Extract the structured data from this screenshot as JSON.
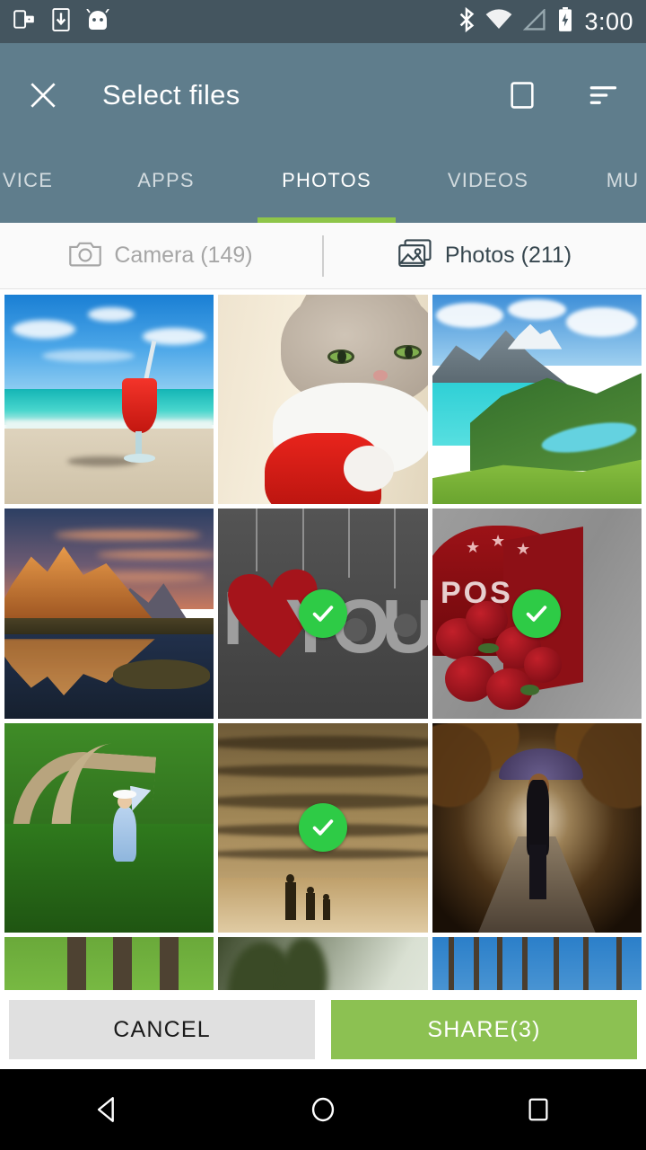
{
  "status_bar": {
    "time": "3:00",
    "left_icons": [
      "screenshot-icon",
      "download-icon",
      "android-head-icon"
    ],
    "right_icons": [
      "bluetooth-icon",
      "wifi-icon",
      "cell-signal-icon",
      "battery-charging-icon"
    ],
    "background_color": "#44555f"
  },
  "toolbar": {
    "title": "Select files",
    "close_icon": "close-icon",
    "select_all_icon": "select-all-square-icon",
    "sort_icon": "sort-icon",
    "background_color": "#5f7d8c",
    "accent_color": "#8ec549"
  },
  "tabs": [
    {
      "label": "VICE",
      "active": false
    },
    {
      "label": "APPS",
      "active": false
    },
    {
      "label": "PHOTOS",
      "active": true
    },
    {
      "label": "VIDEOS",
      "active": false
    },
    {
      "label": "MU",
      "active": false
    }
  ],
  "sources": [
    {
      "label": "Camera (149)",
      "icon": "camera-icon",
      "active": false
    },
    {
      "label": "Photos (211)",
      "icon": "photo-stack-icon",
      "active": true
    }
  ],
  "grid": {
    "selected_check_color": "#2ecb46",
    "items": [
      {
        "name": "beach-cocktail",
        "selected": false
      },
      {
        "name": "cat-santa-hat",
        "selected": false
      },
      {
        "name": "lake-green-mountains",
        "selected": false
      },
      {
        "name": "orange-mountain-reflection",
        "selected": false
      },
      {
        "name": "i-love-you-letters",
        "selected": true
      },
      {
        "name": "red-mailbox-carnations",
        "selected": true
      },
      {
        "name": "green-field-boardwalk",
        "selected": false
      },
      {
        "name": "beach-family-silhouette",
        "selected": true
      },
      {
        "name": "autumn-tunnel-umbrella",
        "selected": false
      },
      {
        "name": "grass-trees",
        "selected": false
      },
      {
        "name": "yellow-flower-hand",
        "selected": false
      },
      {
        "name": "bare-trees-blue-sky",
        "selected": false
      }
    ]
  },
  "actions": {
    "cancel_label": "CANCEL",
    "share_label": "SHARE(3)",
    "share_color": "#8cc152",
    "cancel_color": "#e0e0e0"
  },
  "navbar": {
    "back_icon": "back-triangle-icon",
    "home_icon": "home-circle-icon",
    "recents_icon": "recents-square-icon"
  }
}
